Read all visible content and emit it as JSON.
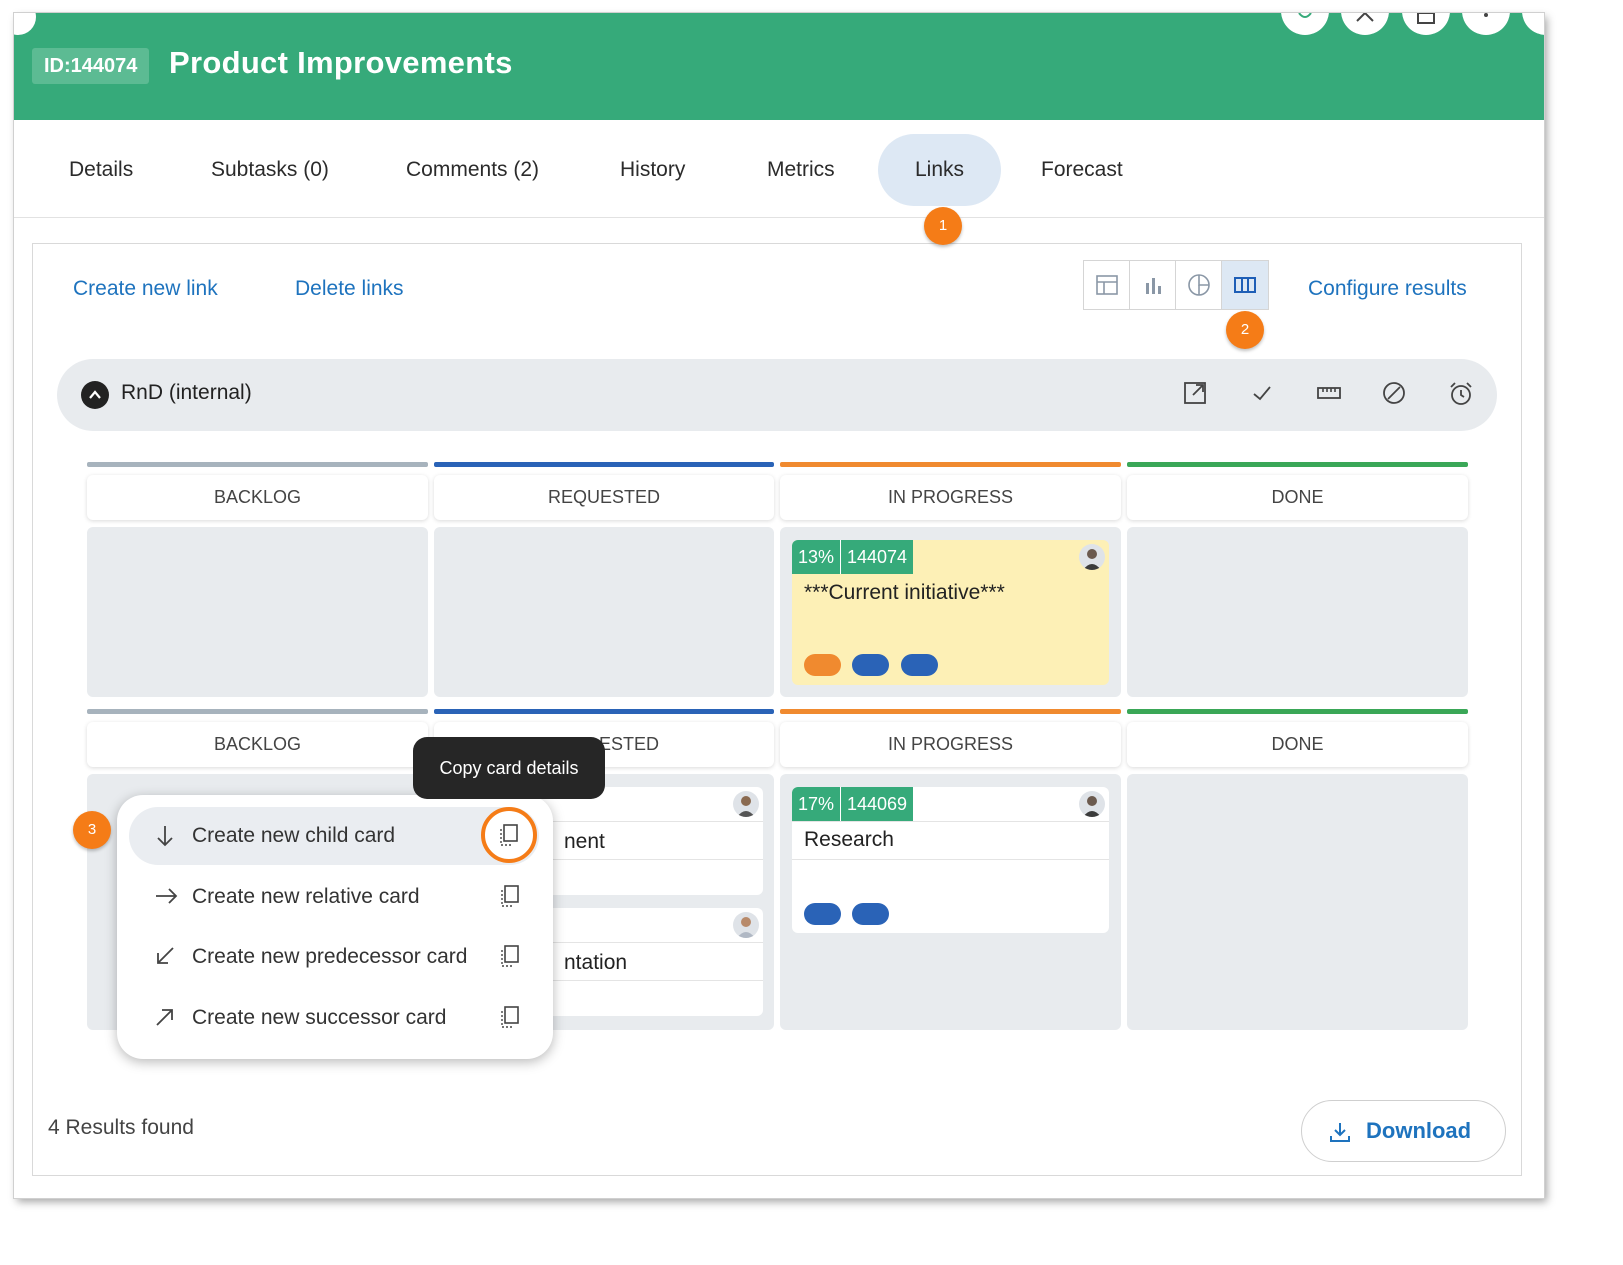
{
  "header": {
    "id_badge": "ID:144074",
    "title": "Product Improvements"
  },
  "tabs": [
    {
      "label": "Details"
    },
    {
      "label": "Subtasks (0)"
    },
    {
      "label": "Comments (2)"
    },
    {
      "label": "History"
    },
    {
      "label": "Metrics"
    },
    {
      "label": "Links",
      "active": true
    },
    {
      "label": "Forecast"
    }
  ],
  "markers": [
    "1",
    "2",
    "3"
  ],
  "toolbar": {
    "create_link": "Create new link",
    "delete_links": "Delete links",
    "configure_results": "Configure results",
    "view_modes": [
      "table-view-icon",
      "bar-chart-icon",
      "pie-chart-icon",
      "board-view-icon"
    ],
    "active_view": "board-view-icon"
  },
  "swimlane": {
    "title": "RnD (internal)",
    "icons": [
      "open-external-icon",
      "check-icon",
      "ruler-icon",
      "block-icon",
      "alarm-clock-icon"
    ]
  },
  "columns": [
    {
      "label": "BACKLOG",
      "color": "#a7b3bd"
    },
    {
      "label": "REQUESTED",
      "color": "#2a63b7"
    },
    {
      "label": "IN PROGRESS",
      "color": "#f08a2f"
    },
    {
      "label": "DONE",
      "color": "#3aa757"
    }
  ],
  "columns_row2": [
    "BACKLOG",
    "ESTED",
    "IN PROGRESS",
    "DONE"
  ],
  "cards": {
    "current": {
      "pct": "13%",
      "id": "144074",
      "title": "***Current initiative***",
      "tags": [
        "#f08a2f",
        "#2a63b7",
        "#2a63b7"
      ]
    },
    "research": {
      "pct": "17%",
      "id": "144069",
      "title": "Research",
      "tags": [
        "#2a63b7",
        "#2a63b7"
      ]
    },
    "partial1": {
      "title": "nent"
    },
    "partial2": {
      "title": "ntation"
    }
  },
  "tooltip": "Copy card details",
  "context_menu": {
    "items": [
      {
        "label": "Create new child card",
        "icon": "arrow-down-icon"
      },
      {
        "label": "Create new relative card",
        "icon": "arrow-right-icon"
      },
      {
        "label": "Create new predecessor card",
        "icon": "arrow-down-left-icon"
      },
      {
        "label": "Create new successor card",
        "icon": "arrow-up-right-icon"
      }
    ]
  },
  "footer": {
    "results": "4 Results found",
    "download": "Download"
  },
  "colors": {
    "header_green": "#36aa7a",
    "accent_orange": "#f57c17",
    "link_blue": "#1e73be"
  }
}
